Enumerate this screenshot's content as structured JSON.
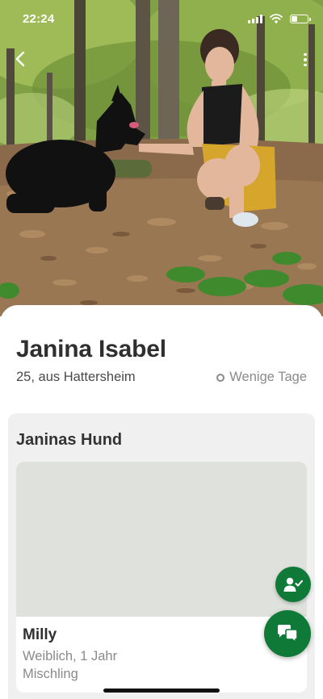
{
  "status_bar": {
    "time": "22:24",
    "icons": [
      "signal-icon",
      "wifi-icon",
      "battery-icon"
    ],
    "battery_level": 0.35
  },
  "nav": {
    "back_icon": "chevron-left-icon",
    "menu_icon": "more-vertical-icon"
  },
  "profile": {
    "name": "Janina Isabel",
    "meta": "25, aus Hattersheim",
    "activity": "Wenige Tage",
    "activity_icon": "status-ring-icon"
  },
  "dog_section": {
    "title": "Janinas Hund",
    "dog": {
      "name": "Milly",
      "details": "Weiblich, 1 Jahr",
      "breed": "Mischling"
    }
  },
  "actions": {
    "add_friend_icon": "user-check-icon",
    "chat_icon": "chat-bubbles-icon"
  },
  "colors": {
    "accent": "#0f7a37",
    "card_background": "#f0f0f0",
    "image_placeholder": "#dee1dc",
    "muted_text": "#8a8a8a"
  }
}
